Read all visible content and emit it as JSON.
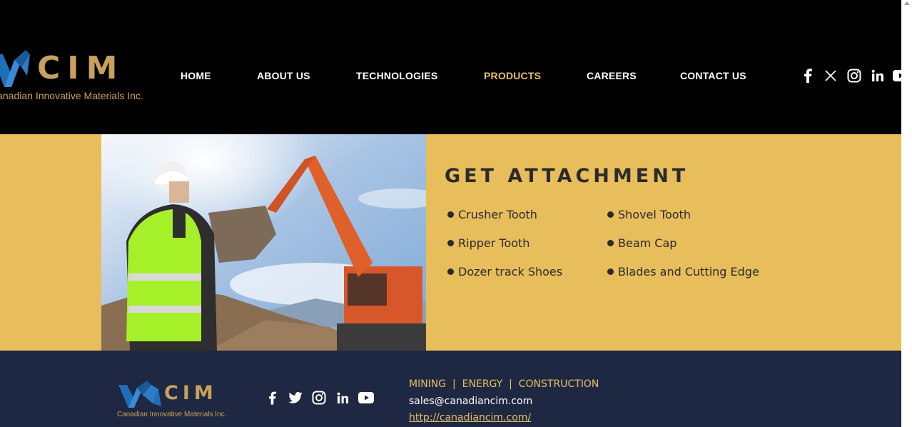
{
  "header": {
    "logo": {
      "wordmark": "CIM",
      "subtitle": "Canadian Innovative Materials Inc."
    },
    "nav": [
      {
        "label": "HOME",
        "active": false
      },
      {
        "label": "ABOUT US",
        "active": false
      },
      {
        "label": "TECHNOLOGIES",
        "active": false
      },
      {
        "label": "PRODUCTS",
        "active": true
      },
      {
        "label": "CAREERS",
        "active": false
      },
      {
        "label": "CONTACT US",
        "active": false
      }
    ],
    "social_icons": [
      "facebook-icon",
      "x-icon",
      "instagram-icon",
      "linkedin-icon",
      "youtube-icon"
    ]
  },
  "main": {
    "image_alt": "construction worker watching excavator",
    "title": "GET ATTACHMENT",
    "left_list": [
      "Crusher Tooth",
      "Ripper Tooth",
      "Dozer track Shoes"
    ],
    "right_list": [
      "Shovel Tooth",
      "Beam Cap",
      "Blades and Cutting Edge"
    ]
  },
  "footer": {
    "logo": {
      "wordmark": "CIM",
      "subtitle": "Canadian Innovative Materials Inc."
    },
    "social_icons": [
      "facebook-icon",
      "twitter-icon",
      "instagram-icon",
      "linkedin-icon",
      "youtube-icon"
    ],
    "tagline": "MINING  |  ENERGY  |  CONSTRUCTION",
    "email": "sales@canadiancim.com",
    "website": "http://canadiancim.com/"
  },
  "colors": {
    "header_bg": "#000000",
    "accent_gold": "#e6c068",
    "band_bg": "#e8bd5c",
    "footer_bg": "#1e2842",
    "logo_blue": "#1f6fb8"
  }
}
